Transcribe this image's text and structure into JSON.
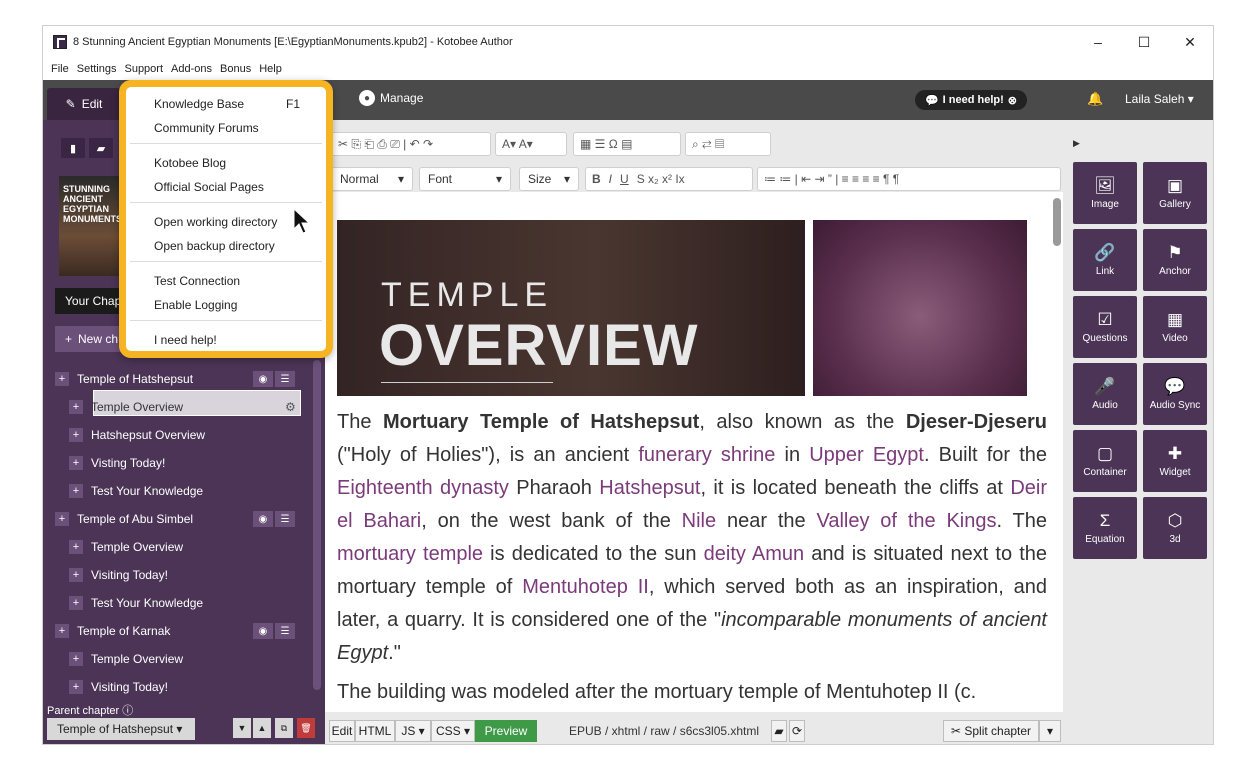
{
  "window": {
    "title": "8 Stunning Ancient Egyptian Monuments [E:\\EgyptianMonuments.kpub2] - Kotobee Author",
    "controls": {
      "minimize": "–",
      "maximize": "☐",
      "close": "✕"
    }
  },
  "menubar": [
    "File",
    "Settings",
    "Support",
    "Add-ons",
    "Bonus",
    "Help"
  ],
  "appbar": {
    "edit_tab": "Edit",
    "manage_tab": "Manage",
    "help_button": "I need help!",
    "user": "Laila Saleh ▾"
  },
  "sidebar": {
    "cover_text": "STUNNING ANCIENT EGYPTIAN MONUMENTS",
    "your_chapters": "Your Chap",
    "new_chapter": "New ch",
    "tree": [
      {
        "label": "Temple of Hatshepsut",
        "level": 0,
        "buttons": true
      },
      {
        "label": "Temple Overview",
        "level": 1,
        "selected": true
      },
      {
        "label": "Hatshepsut Overview",
        "level": 1
      },
      {
        "label": "Visting Today!",
        "level": 1
      },
      {
        "label": "Test Your Knowledge",
        "level": 1
      },
      {
        "label": "Temple of Abu Simbel",
        "level": 0,
        "buttons": true
      },
      {
        "label": "Temple Overview",
        "level": 1
      },
      {
        "label": "Visiting Today!",
        "level": 1
      },
      {
        "label": "Test Your Knowledge",
        "level": 1
      },
      {
        "label": "Temple of Karnak",
        "level": 0,
        "buttons": true
      },
      {
        "label": "Temple Overview",
        "level": 1
      },
      {
        "label": "Visiting Today!",
        "level": 1
      }
    ],
    "parent_chapter_label": "Parent chapter",
    "parent_chapter_value": "Temple of Hatshepsut ▾"
  },
  "toolbar": {
    "format_select": "Normal",
    "font_select": "Font",
    "size_select": "Size"
  },
  "editor": {
    "banner_small": "TEMPLE",
    "banner_big": "OVERVIEW",
    "paragraph1": [
      {
        "t": "The "
      },
      {
        "t": "Mortuary Temple of Hatshepsut",
        "b": true
      },
      {
        "t": ", also known as the "
      },
      {
        "t": "Djeser-Djeseru",
        "b": true
      },
      {
        "t": " (\"Holy of Holies\"), is an ancient "
      },
      {
        "t": "funerary shrine",
        "l": true
      },
      {
        "t": " in "
      },
      {
        "t": "Upper Egypt",
        "l": true
      },
      {
        "t": ". Built for the "
      },
      {
        "t": "Eighteenth dynasty",
        "l": true
      },
      {
        "t": " Pharaoh "
      },
      {
        "t": "Hatshepsut",
        "l": true
      },
      {
        "t": ", it is located beneath the cliffs at "
      },
      {
        "t": "Deir el Bahari",
        "l": true
      },
      {
        "t": ", on the west bank of the "
      },
      {
        "t": "Nile",
        "l": true
      },
      {
        "t": " near the "
      },
      {
        "t": "Valley of the Kings",
        "l": true
      },
      {
        "t": ". The "
      },
      {
        "t": "mortuary temple",
        "l": true
      },
      {
        "t": " is dedicated to the sun "
      },
      {
        "t": "deity",
        "l": true
      },
      {
        "t": " "
      },
      {
        "t": "Amun",
        "l": true
      },
      {
        "t": " and is situated next to the mortuary temple of "
      },
      {
        "t": "Mentuhotep II",
        "l": true
      },
      {
        "t": ", which served both as an inspiration, and later, a quarry. It is considered one of the \""
      },
      {
        "t": "incomparable monuments of ancient Egypt",
        "i": true
      },
      {
        "t": ".\""
      }
    ],
    "paragraph2": "The building was modeled after the mortuary temple of Mentuhotep II (c."
  },
  "bottombar": {
    "edit": "Edit",
    "html": "HTML",
    "js": "JS ▾",
    "css": "CSS ▾",
    "preview": "Preview",
    "path": "EPUB / xhtml / raw / s6cs3l05.xhtml",
    "split": "Split chapter"
  },
  "right_panel": [
    {
      "label": "Image",
      "icon": "image-icon",
      "glyph": "🖼"
    },
    {
      "label": "Gallery",
      "icon": "gallery-icon",
      "glyph": "▣"
    },
    {
      "label": "Link",
      "icon": "link-icon",
      "glyph": "🔗"
    },
    {
      "label": "Anchor",
      "icon": "anchor-icon",
      "glyph": "⚑"
    },
    {
      "label": "Questions",
      "icon": "questions-icon",
      "glyph": "☑"
    },
    {
      "label": "Video",
      "icon": "video-icon",
      "glyph": "▦"
    },
    {
      "label": "Audio",
      "icon": "audio-icon",
      "glyph": "🎤"
    },
    {
      "label": "Audio Sync",
      "icon": "audio-sync-icon",
      "glyph": "💬"
    },
    {
      "label": "Container",
      "icon": "container-icon",
      "glyph": "▢"
    },
    {
      "label": "Widget",
      "icon": "widget-icon",
      "glyph": "✚"
    },
    {
      "label": "Equation",
      "icon": "equation-icon",
      "glyph": "Σ"
    },
    {
      "label": "3d",
      "icon": "cube-icon",
      "glyph": "⬡"
    }
  ],
  "help_menu": {
    "items": [
      {
        "label": "Knowledge Base",
        "shortcut": "F1"
      },
      {
        "label": "Community Forums"
      },
      {
        "label": "Kotobee Blog"
      },
      {
        "label": "Official Social Pages"
      },
      {
        "label": "Open working directory"
      },
      {
        "label": "Open backup directory"
      },
      {
        "label": "Test Connection"
      },
      {
        "label": "Enable Logging"
      },
      {
        "label": "I need help!"
      }
    ]
  },
  "colors": {
    "sidebar": "#4b3456",
    "accent": "#7b3a7a",
    "highlight": "#f6b322",
    "preview": "#3f9a48"
  }
}
